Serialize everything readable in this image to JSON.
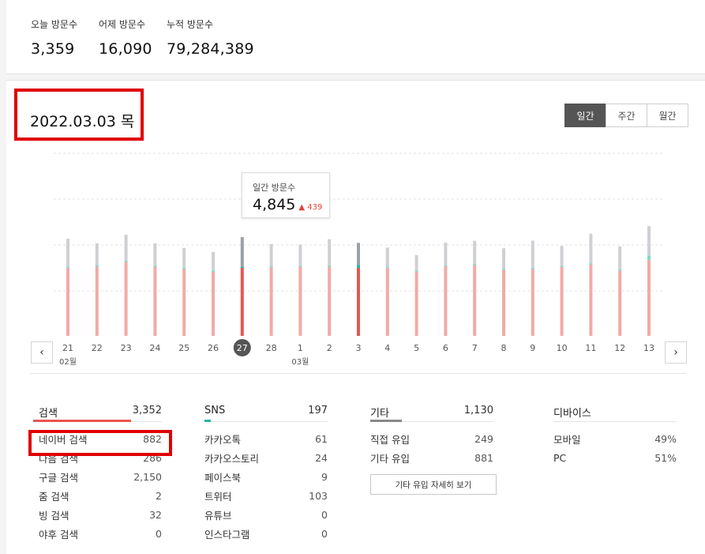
{
  "summary": {
    "today_label": "오늘 방문수",
    "today_value": "3,359",
    "yesterday_label": "어제 방문수",
    "yesterday_value": "16,090",
    "total_label": "누적 방문수",
    "total_value": "79,284,389"
  },
  "date_title": "2022.03.03 목",
  "periods": [
    "일간",
    "주간",
    "월간"
  ],
  "active_period": 0,
  "tooltip": {
    "title": "일간 방문수",
    "value": "4,845",
    "delta_arrow": "▲",
    "delta": "439"
  },
  "colors": {
    "search": "#f2aaa6",
    "search_active": "#e8564f",
    "other": "#cfd0d4",
    "other_active": "#9aa0a6",
    "sns": "#7fd8cc",
    "sns_active": "#23b5a3",
    "accent_red": "#e00000"
  },
  "chart_data": {
    "type": "bar",
    "stacked": true,
    "categories": [
      "21",
      "22",
      "23",
      "24",
      "25",
      "26",
      "27",
      "28",
      "1",
      "2",
      "3",
      "4",
      "5",
      "6",
      "7",
      "8",
      "9",
      "10",
      "11",
      "12",
      "13"
    ],
    "month_labels": [
      {
        "index": 0,
        "text": "02월"
      },
      {
        "index": 8,
        "text": "03월"
      }
    ],
    "selected_index": 6,
    "today_index": 10,
    "series": [
      {
        "key": "search",
        "values": [
          3280,
          3350,
          3580,
          3350,
          3230,
          3100,
          3290,
          3320,
          3350,
          3350,
          3290,
          3300,
          3100,
          3370,
          3430,
          3200,
          3230,
          3330,
          3450,
          3150,
          3680
        ]
      },
      {
        "key": "sns",
        "values": [
          60,
          70,
          60,
          60,
          60,
          60,
          60,
          60,
          60,
          60,
          140,
          60,
          60,
          60,
          60,
          60,
          60,
          60,
          60,
          60,
          210
        ]
      },
      {
        "key": "other",
        "values": [
          1360,
          1060,
          1250,
          1070,
          960,
          900,
          1430,
          1060,
          1010,
          1270,
          1070,
          910,
          750,
          1080,
          1110,
          980,
          1320,
          960,
          1430,
          1120,
          1420
        ]
      }
    ],
    "ylim": [
      0,
      6500
    ],
    "grid": true
  },
  "stats": {
    "search": {
      "title": "검색",
      "total": "3,352",
      "rows": [
        {
          "label": "네이버 검색",
          "value": "882"
        },
        {
          "label": "다음 검색",
          "value": "286"
        },
        {
          "label": "구글 검색",
          "value": "2,150"
        },
        {
          "label": "줌 검색",
          "value": "2"
        },
        {
          "label": "빙 검색",
          "value": "32"
        },
        {
          "label": "야후 검색",
          "value": "0"
        }
      ]
    },
    "sns": {
      "title": "SNS",
      "total": "197",
      "rows": [
        {
          "label": "카카오톡",
          "value": "61"
        },
        {
          "label": "카카오스토리",
          "value": "24"
        },
        {
          "label": "페이스북",
          "value": "9"
        },
        {
          "label": "트위터",
          "value": "103"
        },
        {
          "label": "유튜브",
          "value": "0"
        },
        {
          "label": "인스타그램",
          "value": "0"
        }
      ]
    },
    "etc": {
      "title": "기타",
      "total": "1,130",
      "rows": [
        {
          "label": "직접 유입",
          "value": "249"
        },
        {
          "label": "기타 유입",
          "value": "881"
        }
      ],
      "more_label": "기타 유입 자세히 보기"
    },
    "device": {
      "title": "디바이스",
      "rows": [
        {
          "label": "모바일",
          "value": "49%"
        },
        {
          "label": "PC",
          "value": "51%"
        }
      ]
    }
  }
}
